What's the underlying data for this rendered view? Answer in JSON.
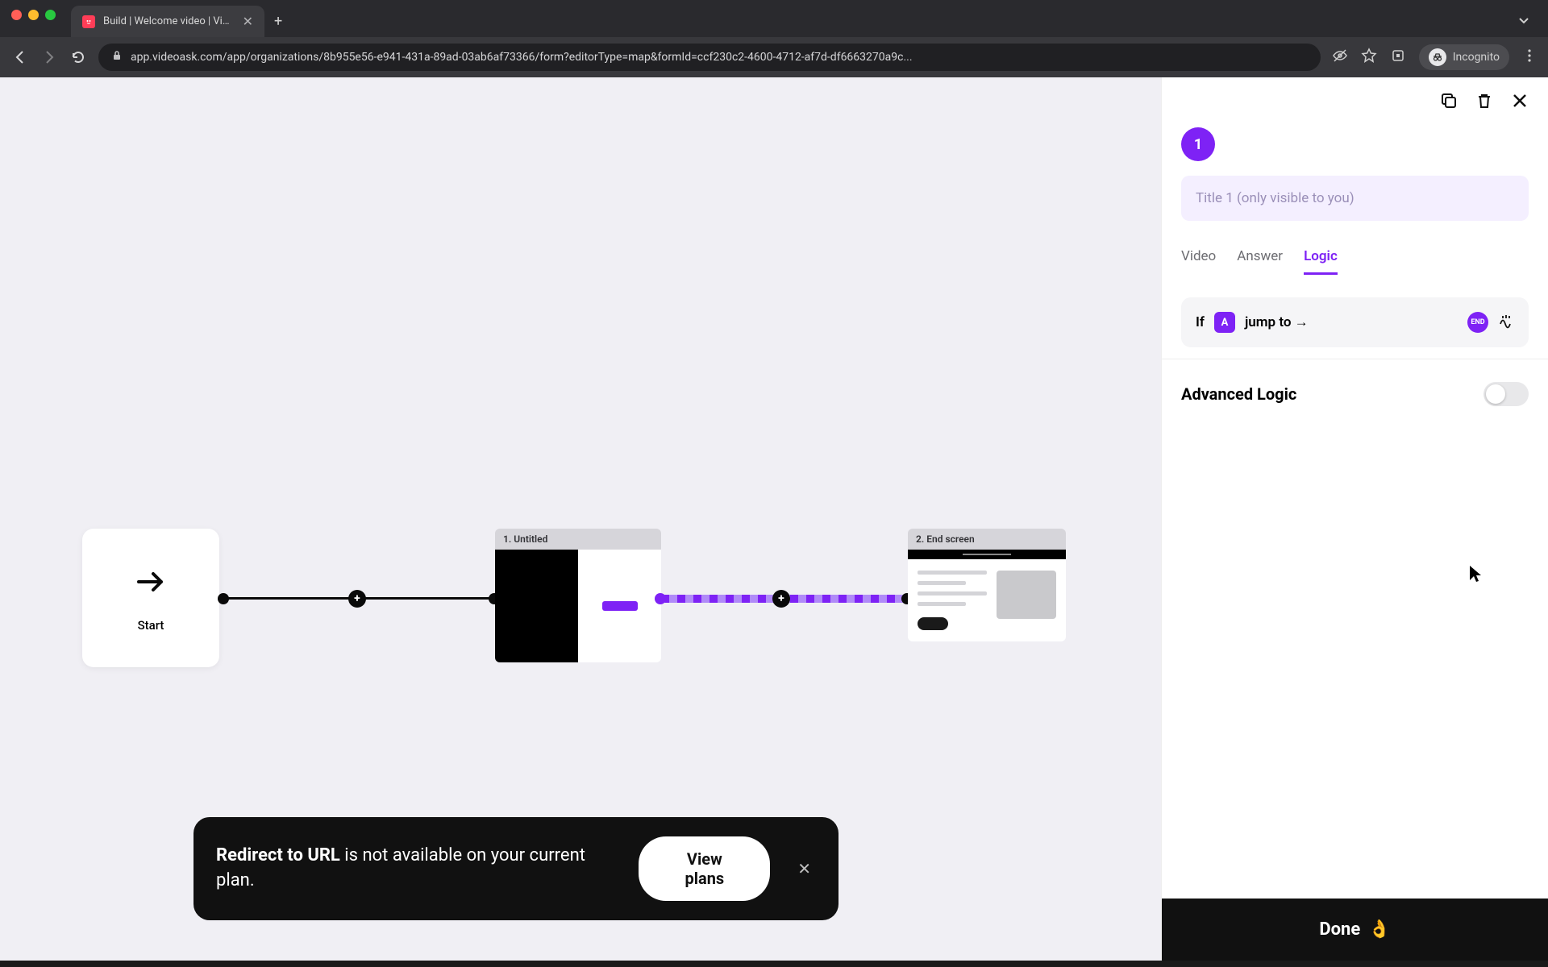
{
  "browser": {
    "tab_title": "Build | Welcome video | VideoA",
    "url": "app.videoask.com/app/organizations/8b955e56-e941-431a-89ad-03ab6af73366/form?editorType=map&formId=ccf230c2-4600-4712-af7d-df6663270a9c...",
    "incognito_label": "Incognito"
  },
  "canvas": {
    "start_label": "Start",
    "step1_header": "1. Untitled",
    "step2_header": "2. End screen"
  },
  "toast": {
    "bold": "Redirect to URL",
    "rest": " is not available on your current plan.",
    "cta": "View plans"
  },
  "panel": {
    "step_number": "1",
    "title_placeholder": "Title 1 (only visible to you)",
    "tabs": {
      "video": "Video",
      "answer": "Answer",
      "logic": "Logic"
    },
    "logic": {
      "if": "If",
      "condition_chip": "A",
      "jump": "jump to →",
      "end_chip": "END"
    },
    "advanced_label": "Advanced Logic",
    "done": "Done"
  }
}
